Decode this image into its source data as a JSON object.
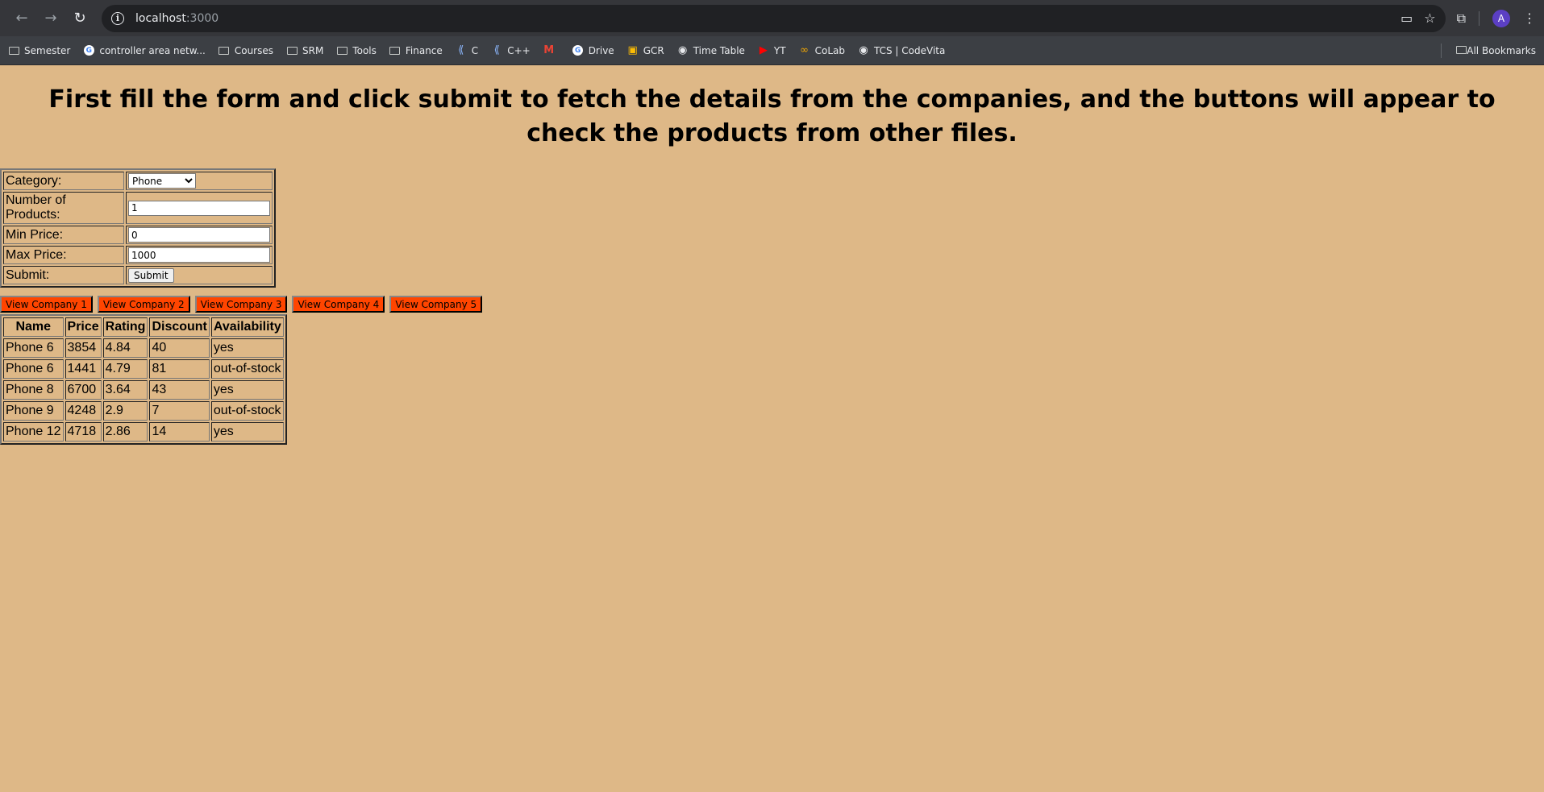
{
  "browser": {
    "url_host": "localhost",
    "url_port": ":3000",
    "avatar_letter": "A",
    "bookmarks": [
      {
        "label": "Semester",
        "icon": "folder-icon"
      },
      {
        "label": "controller area netw...",
        "icon": "google-icon"
      },
      {
        "label": "Courses",
        "icon": "folder-icon"
      },
      {
        "label": "SRM",
        "icon": "folder-icon"
      },
      {
        "label": "Tools",
        "icon": "folder-icon"
      },
      {
        "label": "Finance",
        "icon": "folder-icon"
      },
      {
        "label": "C",
        "icon": "code-icon"
      },
      {
        "label": "C++",
        "icon": "code-icon"
      },
      {
        "label": "",
        "icon": "gmail-icon"
      },
      {
        "label": "Drive",
        "icon": "google-icon"
      },
      {
        "label": "GCR",
        "icon": "classroom-icon"
      },
      {
        "label": "Time Table",
        "icon": "globe-icon"
      },
      {
        "label": "YT",
        "icon": "youtube-icon"
      },
      {
        "label": "CoLab",
        "icon": "colab-icon"
      },
      {
        "label": "TCS | CodeVita",
        "icon": "globe-icon"
      }
    ],
    "all_bookmarks": "All Bookmarks"
  },
  "page": {
    "heading": "First fill the form and click submit to fetch the details from the companies, and the buttons will appear to check the products from other files.",
    "form": {
      "category_label": "Category:",
      "category_value": "Phone",
      "num_products_label": "Number of Products:",
      "num_products_value": "1",
      "min_price_label": "Min Price:",
      "min_price_value": "0",
      "max_price_label": "Max Price:",
      "max_price_value": "1000",
      "submit_label": "Submit:",
      "submit_button": "Submit"
    },
    "company_buttons": [
      "View Company 1",
      "View Company 2",
      "View Company 3",
      "View Company 4",
      "View Company 5"
    ],
    "colors": {
      "page_bg": "#deb887",
      "company_button_bg": "#ff4500"
    },
    "products": {
      "headers": [
        "Name",
        "Price",
        "Rating",
        "Discount",
        "Availability"
      ],
      "rows": [
        [
          "Phone 6",
          "3854",
          "4.84",
          "40",
          "yes"
        ],
        [
          "Phone 6",
          "1441",
          "4.79",
          "81",
          "out-of-stock"
        ],
        [
          "Phone 8",
          "6700",
          "3.64",
          "43",
          "yes"
        ],
        [
          "Phone 9",
          "4248",
          "2.9",
          "7",
          "out-of-stock"
        ],
        [
          "Phone 12",
          "4718",
          "2.86",
          "14",
          "yes"
        ]
      ]
    }
  }
}
